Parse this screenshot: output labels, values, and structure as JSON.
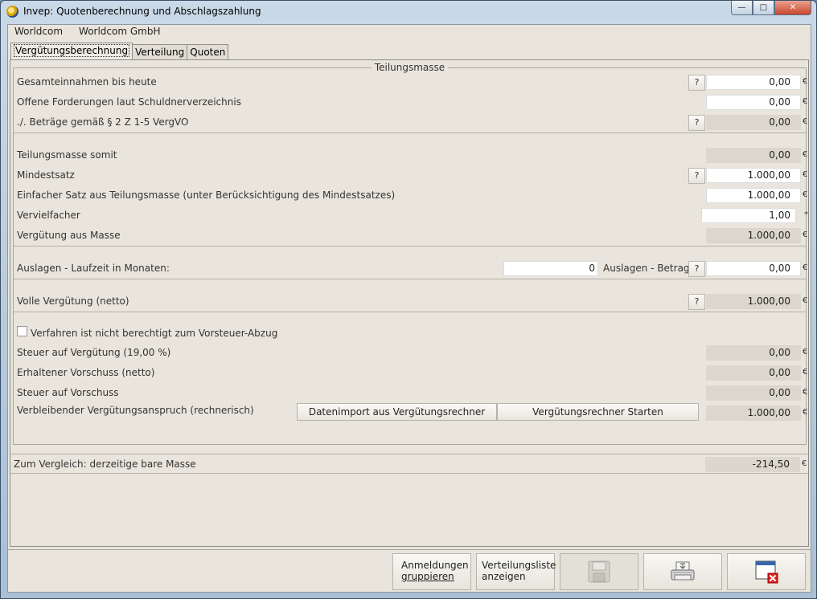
{
  "window": {
    "title": "Invep: Quotenberechnung und Abschlagszahlung",
    "caption_min": "—",
    "caption_max": "□",
    "caption_close": "✕"
  },
  "menu": [
    "Worldcom",
    "Worldcom GmbH"
  ],
  "tabs": [
    "Vergütungsberechnung",
    "Verteilung",
    "Quoten"
  ],
  "group": {
    "title": "Teilungsmasse"
  },
  "currency": "€",
  "multiplier_suffix": "*",
  "help_label": "?",
  "rows": {
    "gesamteinnahmen": {
      "label": "Gesamteinnahmen bis heute",
      "value": "0,00"
    },
    "offene_forderungen": {
      "label": "Offene Forderungen laut Schuldnerverzeichnis",
      "value": "0,00"
    },
    "betraege": {
      "label": "./. Beträge gemäß § 2 Z 1-5 VergVO",
      "value": "0,00"
    },
    "teilungsmasse": {
      "label": "Teilungsmasse somit",
      "value": "0,00"
    },
    "mindestsatz": {
      "label": "Mindestsatz",
      "value": "1.000,00"
    },
    "einfacher_satz": {
      "label": "Einfacher Satz aus Teilungsmasse (unter Berücksichtigung des Mindestsatzes)",
      "value": "1.000,00"
    },
    "vervielfacher": {
      "label": "Vervielfacher",
      "value": "1,00"
    },
    "verguetung_masse": {
      "label": "Vergütung aus Masse",
      "value": "1.000,00"
    },
    "auslagen_laufzeit": {
      "label": "Auslagen - Laufzeit in Monaten:",
      "value": "0"
    },
    "auslagen_betrag": {
      "label": "Auslagen - Betrag:",
      "value": "0,00"
    },
    "volle_verguetung": {
      "label": "Volle Vergütung (netto)",
      "value": "1.000,00"
    },
    "vorsteuer_checkbox": {
      "label": "Verfahren ist nicht berechtigt zum Vorsteuer-Abzug",
      "checked": false
    },
    "steuer_verguetung": {
      "label": "Steuer auf Vergütung (19,00 %)",
      "value": "0,00"
    },
    "vorschuss": {
      "label": "Erhaltener Vorschuss (netto)",
      "value": "0,00"
    },
    "steuer_vorschuss": {
      "label": "Steuer auf Vorschuss",
      "value": "0,00"
    },
    "verbleibend": {
      "label": "Verbleibender Vergütungsanspruch (rechnerisch)",
      "value": "1.000,00"
    }
  },
  "buttons": {
    "datenimport": "Datenimport aus Vergütungsrechner",
    "rechner_starten": "Vergütungsrechner Starten"
  },
  "vergleich": {
    "label": "Zum Vergleich: derzeitige bare Masse",
    "value": "-214,50"
  },
  "bottom_buttons": {
    "anmeldungen_line1": "Anmeldungen",
    "anmeldungen_line2": "gruppieren",
    "verteilungsliste_line1": "Verteilungsliste",
    "verteilungsliste_line2": "anzeigen"
  }
}
